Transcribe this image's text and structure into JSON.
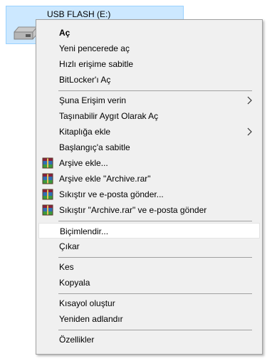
{
  "drive": {
    "label": "USB FLASH (E:)"
  },
  "menu": {
    "items": [
      {
        "label": "Aç",
        "bold": true
      },
      {
        "label": "Yeni pencerede aç"
      },
      {
        "label": "Hızlı erişime sabitle"
      },
      {
        "label": "BitLocker'ı Aç"
      },
      {
        "label": "Şuna Erişim verin",
        "submenu": true
      },
      {
        "label": "Taşınabilir Aygıt Olarak Aç"
      },
      {
        "label": "Kitaplığa ekle",
        "submenu": true
      },
      {
        "label": "Başlangıç'a sabitle"
      },
      {
        "label": "Arşive ekle...",
        "icon": "winrar-icon"
      },
      {
        "label": "Arşive ekle \"Archive.rar\"",
        "icon": "winrar-icon"
      },
      {
        "label": "Sıkıştır ve e-posta gönder...",
        "icon": "winrar-icon"
      },
      {
        "label": "Sıkıştır \"Archive.rar\" ve e-posta gönder",
        "icon": "winrar-icon"
      },
      {
        "label": "Biçimlendir...",
        "highlighted": true
      },
      {
        "label": "Çıkar"
      },
      {
        "label": "Kes"
      },
      {
        "label": "Kopyala"
      },
      {
        "label": "Kısayol oluştur"
      },
      {
        "label": "Yeniden adlandır"
      },
      {
        "label": "Özellikler"
      }
    ]
  },
  "colors": {
    "selection": "#cce8ff",
    "menu_background": "#f0f0f0",
    "menu_border": "#a0a0a0"
  }
}
